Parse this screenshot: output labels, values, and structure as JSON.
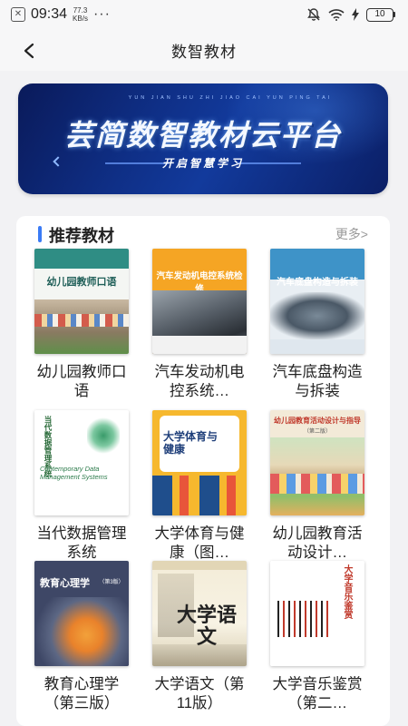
{
  "status_bar": {
    "app_icon": "close-box-icon",
    "time": "09:34",
    "speed_value": "77.3",
    "speed_unit": "KB/s",
    "more": "···",
    "battery": "10"
  },
  "nav": {
    "title": "数智教材"
  },
  "banner": {
    "pinyin": "YUN JIAN SHU ZHI JIAO CAI YUN PING TAI",
    "title": "芸简数智教材云平台",
    "subtitle": "开启智慧学习"
  },
  "section": {
    "title": "推荐教材",
    "more": "更多>"
  },
  "books": [
    {
      "title": "幼儿园教师口语",
      "cover_title": "幼儿园教师口语"
    },
    {
      "title": "汽车发动机电控系统…",
      "cover_title": "汽车发动机电控系统检修"
    },
    {
      "title": "汽车底盘构造与拆装",
      "cover_title": "汽车底盘构造与拆装"
    },
    {
      "title": "当代数据管理系统",
      "cover_title": "当代数据管理系统",
      "cover_subtitle": "Contemporary Data Management Systems"
    },
    {
      "title": "大学体育与健康（图…",
      "cover_title": "大学体育与健康"
    },
    {
      "title": "幼儿园教育活动设计…",
      "cover_title": "幼儿园教育活动设计与指导",
      "cover_edition": "（第二版）"
    },
    {
      "title": "教育心理学（第三版）",
      "cover_title": "教育心理学",
      "cover_edition": "（第3版）"
    },
    {
      "title": "大学语文（第11版）",
      "cover_title": "大学语文"
    },
    {
      "title": "大学音乐鉴赏（第二…",
      "cover_title": "大学音乐鉴赏"
    }
  ]
}
